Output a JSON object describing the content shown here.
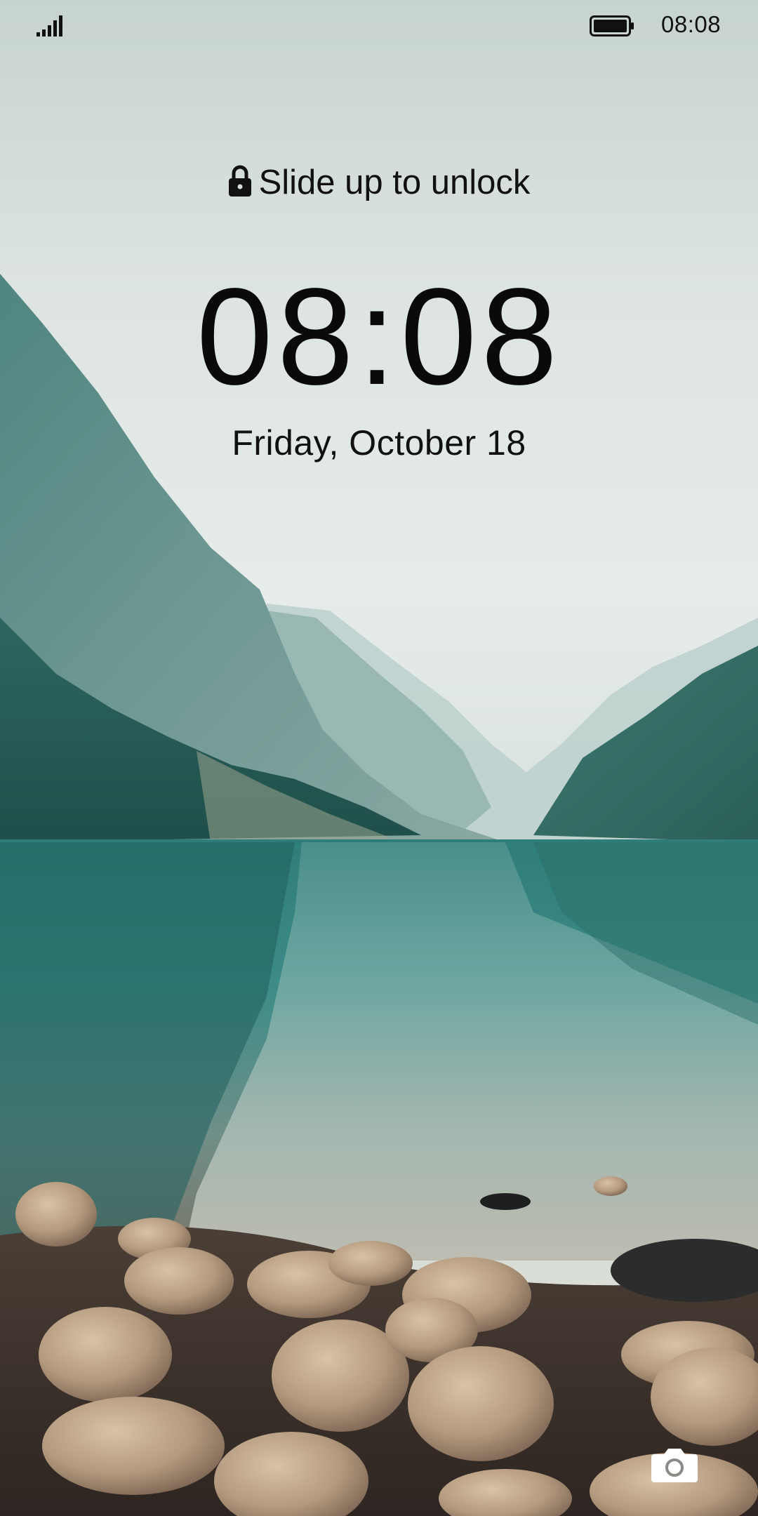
{
  "status_bar": {
    "signal_icon": "signal-bars-icon",
    "battery_icon": "battery-full-icon",
    "time": "08:08"
  },
  "lockscreen": {
    "unlock_hint": "Slide up to unlock",
    "lock_icon": "lock-icon",
    "clock": "08:08",
    "date": "Friday, October 18"
  },
  "shortcuts": {
    "camera_icon": "camera-icon"
  }
}
